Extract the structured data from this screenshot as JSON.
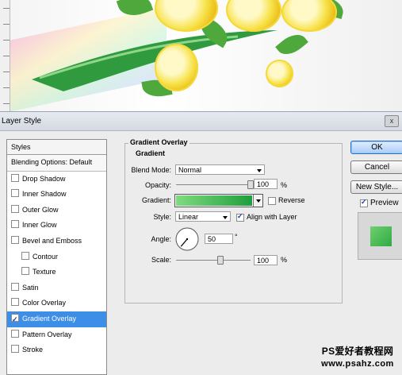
{
  "dialog": {
    "title": "Layer Style",
    "close_glyph": "x"
  },
  "styles_list": {
    "header": "Styles",
    "blending_options": "Blending Options: Default",
    "items": [
      {
        "label": "Drop Shadow",
        "checked": false,
        "sub": false
      },
      {
        "label": "Inner Shadow",
        "checked": false,
        "sub": false
      },
      {
        "label": "Outer Glow",
        "checked": false,
        "sub": false
      },
      {
        "label": "Inner Glow",
        "checked": false,
        "sub": false
      },
      {
        "label": "Bevel and Emboss",
        "checked": false,
        "sub": false
      },
      {
        "label": "Contour",
        "checked": false,
        "sub": true
      },
      {
        "label": "Texture",
        "checked": false,
        "sub": true
      },
      {
        "label": "Satin",
        "checked": false,
        "sub": false
      },
      {
        "label": "Color Overlay",
        "checked": false,
        "sub": false
      },
      {
        "label": "Gradient Overlay",
        "checked": true,
        "sub": false,
        "selected": true
      },
      {
        "label": "Pattern Overlay",
        "checked": false,
        "sub": false
      },
      {
        "label": "Stroke",
        "checked": false,
        "sub": false
      }
    ]
  },
  "gradient_overlay": {
    "group_title": "Gradient Overlay",
    "section_title": "Gradient",
    "blend_mode_label": "Blend Mode:",
    "blend_mode_value": "Normal",
    "opacity_label": "Opacity:",
    "opacity_value": "100",
    "opacity_unit": "%",
    "opacity_slider": 1.0,
    "gradient_label": "Gradient:",
    "gradient_colors": [
      "#7fdc7f",
      "#1f9e3c"
    ],
    "reverse_label": "Reverse",
    "reverse_checked": false,
    "style_label": "Style:",
    "style_value": "Linear",
    "align_label": "Align with Layer",
    "align_checked": true,
    "angle_label": "Angle:",
    "angle_value": "50",
    "angle_unit": "°",
    "scale_label": "Scale:",
    "scale_value": "100",
    "scale_unit": "%",
    "scale_slider": 0.6
  },
  "buttons": {
    "ok": "OK",
    "cancel": "Cancel",
    "new_style": "New Style...",
    "preview_label": "Preview",
    "preview_checked": true
  },
  "preview_swatch_colors": [
    "#6fd06f",
    "#2faa43"
  ],
  "watermark": {
    "line1": "PS爱好者教程网",
    "line2": "www.psahz.com"
  }
}
